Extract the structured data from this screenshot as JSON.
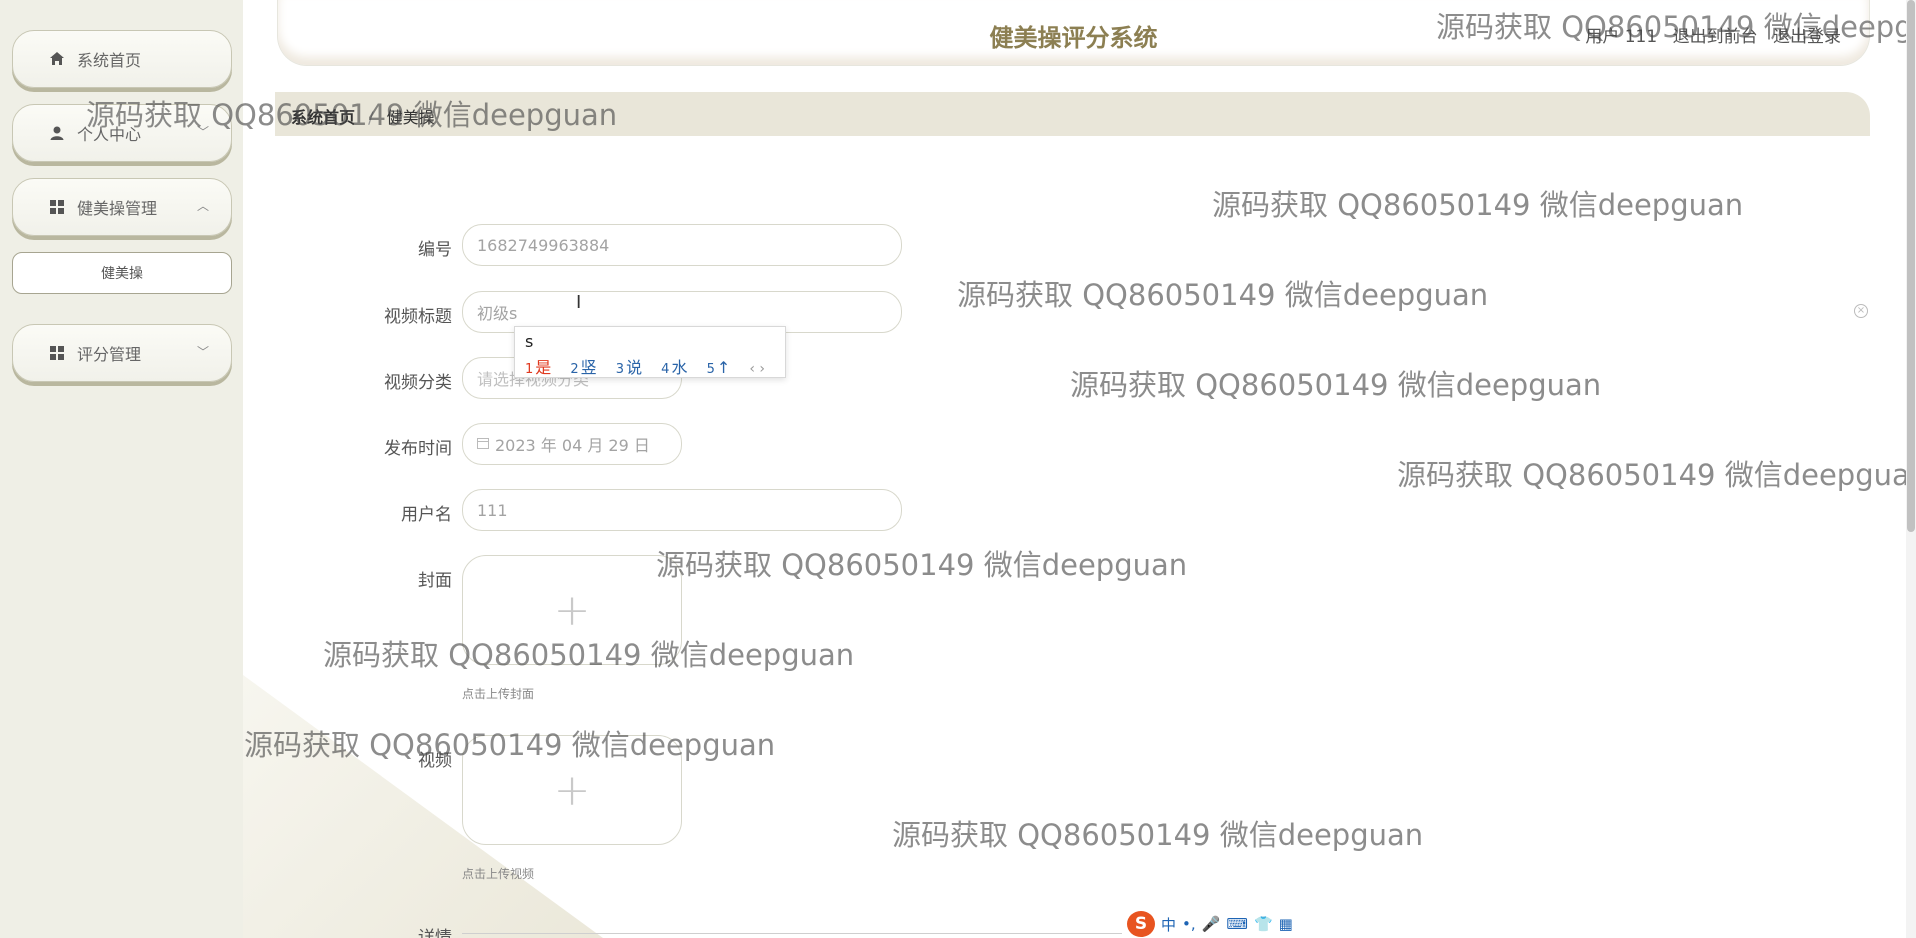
{
  "app": {
    "title": "健美操评分系统",
    "header_links": [
      "用户 111",
      "退出到前台",
      "退出登录"
    ]
  },
  "sidebar": {
    "items": [
      {
        "label": "系统首页",
        "icon": "home-icon",
        "chevron": ""
      },
      {
        "label": "个人中心",
        "icon": "user-icon",
        "chevron": "﹀"
      },
      {
        "label": "健美操管理",
        "icon": "grid-icon",
        "chevron": "︿"
      },
      {
        "label": "评分管理",
        "icon": "grid-icon",
        "chevron": "﹀"
      }
    ],
    "subitem": "健美操"
  },
  "breadcrumb": {
    "home": "系统首页",
    "separator": "/",
    "current": "健美操"
  },
  "form": {
    "id_label": "编号",
    "id_value": "1682749963884",
    "title_label": "视频标题",
    "title_value": "初级s",
    "category_label": "视频分类",
    "category_placeholder": "请选择视频分类",
    "date_label": "发布时间",
    "date_value": "2023 年 04 月 29 日",
    "username_label": "用户名",
    "username_value": "111",
    "cover_label": "封面",
    "cover_hint": "点击上传封面",
    "video_label": "视频",
    "video_hint": "点击上传视频",
    "detail_label": "详情"
  },
  "ime": {
    "composition": "s",
    "candidates": [
      {
        "num": "1",
        "text": "是"
      },
      {
        "num": "2",
        "text": "竖"
      },
      {
        "num": "3",
        "text": "说"
      },
      {
        "num": "4",
        "text": "水"
      },
      {
        "num": "5",
        "text": "↑"
      }
    ],
    "toolbar": [
      "中",
      "•,",
      "🎤",
      "⌨",
      "👕",
      "▦"
    ]
  },
  "watermark": "源码获取 QQ86050149 微信deepguan",
  "colors": {
    "accent": "#8c7f52",
    "sidebar_bg": "#efefe6",
    "breadcrumb_bg": "#e9e6d9"
  }
}
